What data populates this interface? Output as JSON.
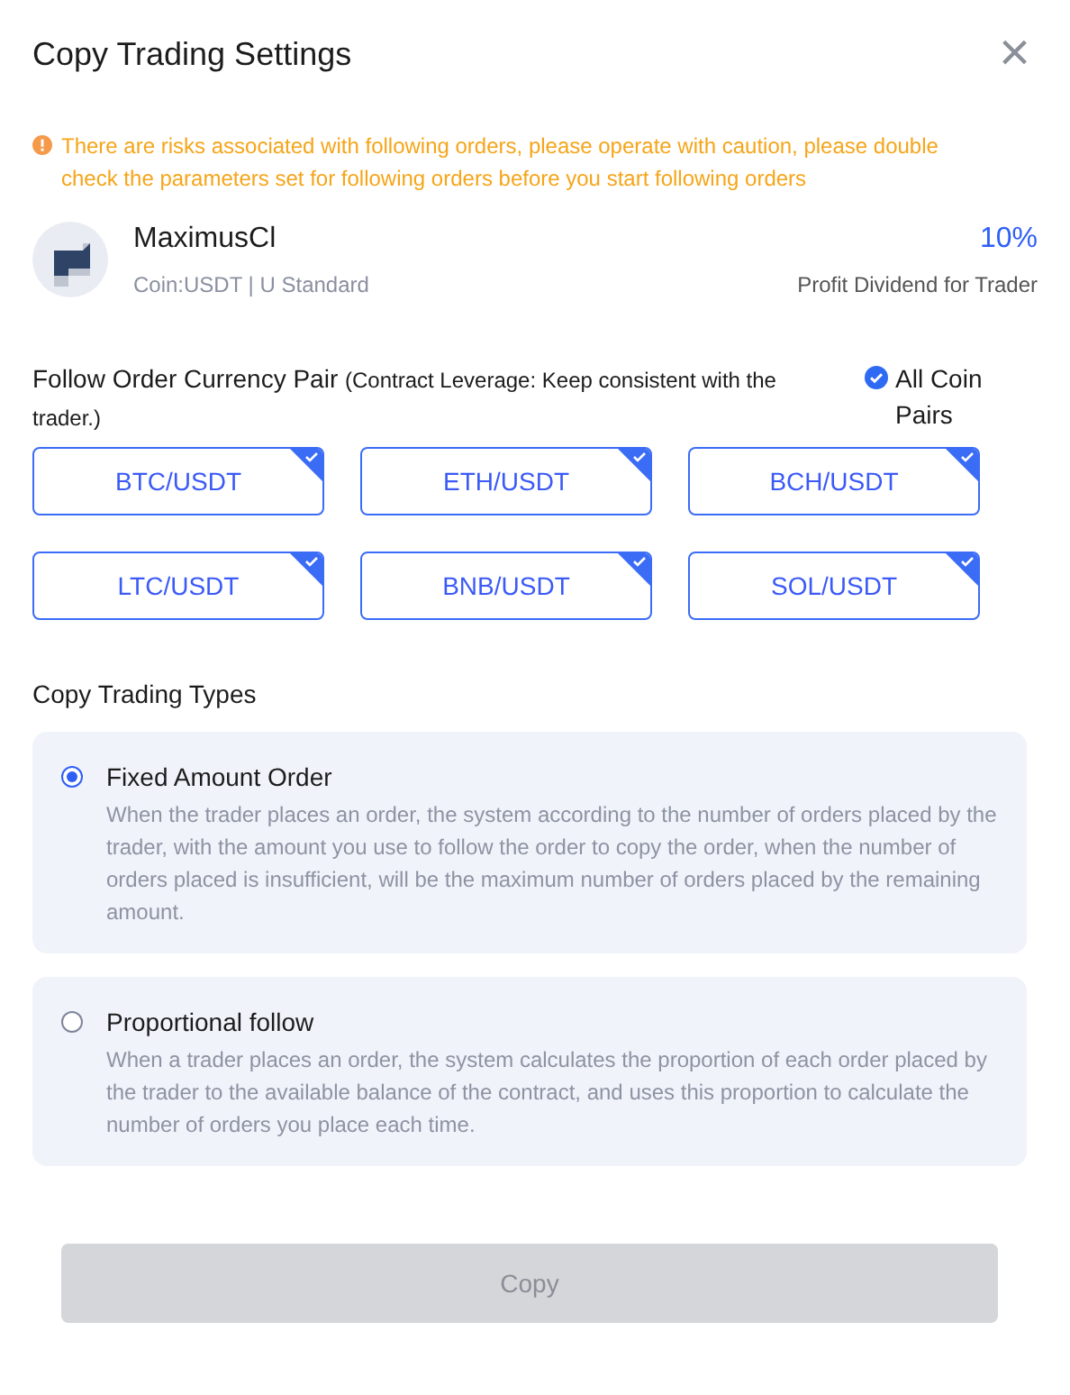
{
  "window": {
    "title": "Copy Trading Settings",
    "close": "×"
  },
  "warning": "There are risks associated with following orders, please operate with caution, please double check the parameters set for following orders before you start following orders",
  "trader": {
    "name": "MaximusCl",
    "meta": "Coin:USDT | U Standard",
    "dividend": "10%",
    "dividend_label": "Profit Dividend for Trader"
  },
  "pairs_section": {
    "label": "Follow Order Currency Pair",
    "note": "(Contract Leverage: Keep consistent with the trader.)",
    "all_pairs": {
      "label": "All Coin Pairs",
      "checked": true
    }
  },
  "pairs": [
    {
      "label": "BTC/USDT",
      "selected": true
    },
    {
      "label": "ETH/USDT",
      "selected": true
    },
    {
      "label": "BCH/USDT",
      "selected": true
    },
    {
      "label": "LTC/USDT",
      "selected": true
    },
    {
      "label": "BNB/USDT",
      "selected": true
    },
    {
      "label": "SOL/USDT",
      "selected": true
    }
  ],
  "types_label": "Copy Trading Types",
  "types": [
    {
      "title": "Fixed Amount Order",
      "description": "When the trader places an order, the system according to the number of orders placed by the trader, with the amount you use to follow the order to copy the order, when the number of orders placed is insufficient, will be the maximum number of orders placed by the remaining amount.",
      "selected": true
    },
    {
      "title": "Proportional follow",
      "description": "When a trader places an order, the system calculates the proportion of each order placed by the trader to the available balance of the contract, and uses this proportion to calculate the number of orders you place each time.",
      "selected": false
    }
  ],
  "copy_button": {
    "label": "Copy",
    "disabled": true
  }
}
